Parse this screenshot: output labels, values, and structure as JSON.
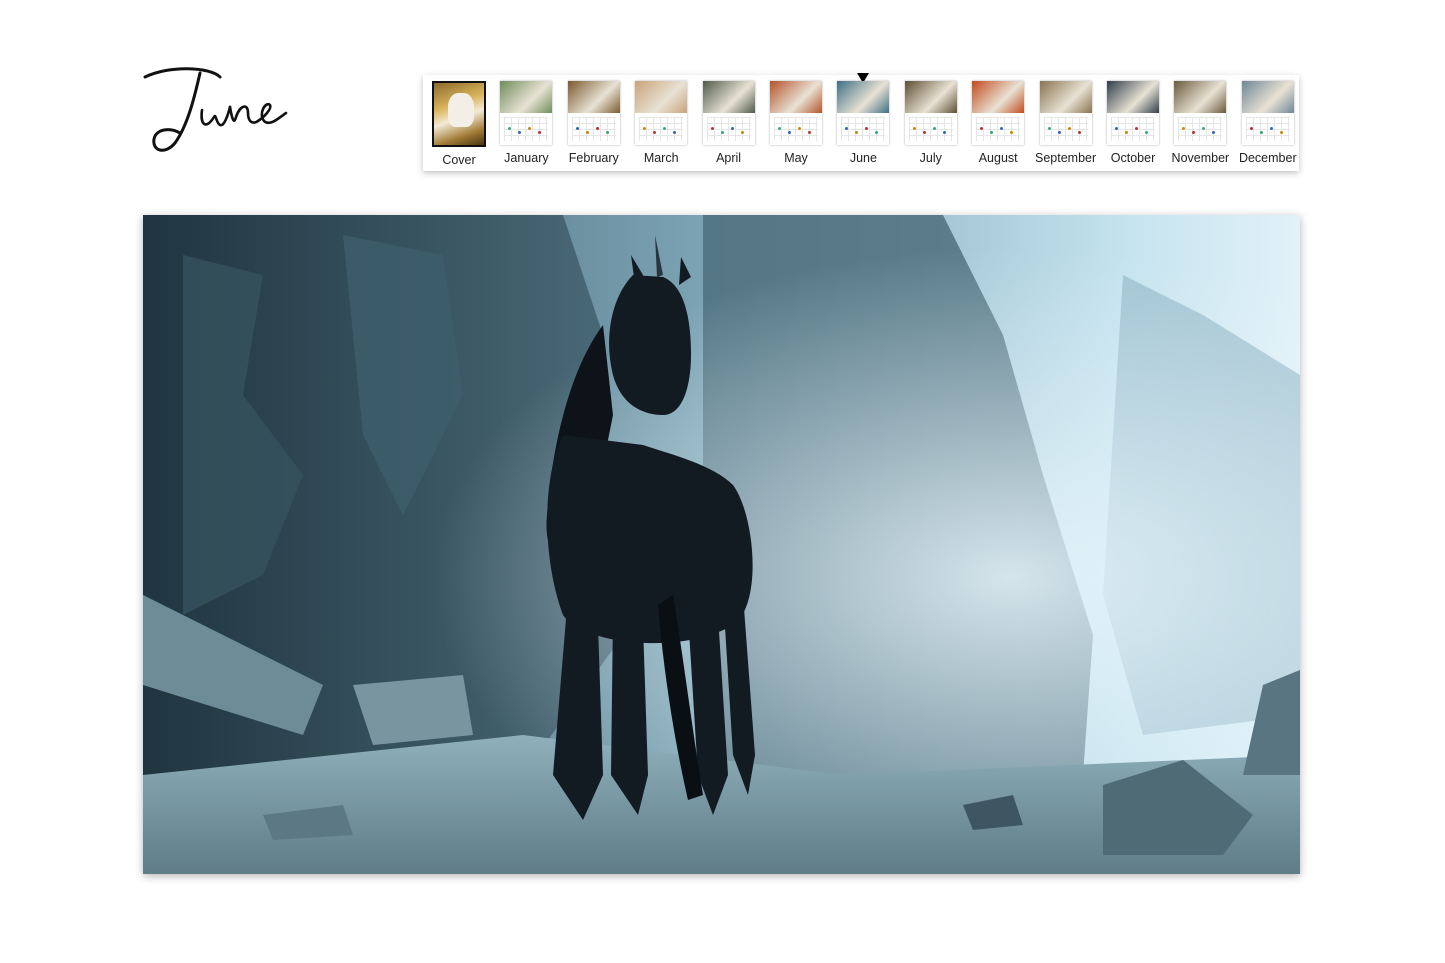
{
  "month_title": "June",
  "strip": {
    "selected": "June",
    "items": [
      {
        "label": "Cover",
        "photo": "#b08a3e"
      },
      {
        "label": "January",
        "photo": "#6f8d5a"
      },
      {
        "label": "February",
        "photo": "#7a5a2e"
      },
      {
        "label": "March",
        "photo": "#c9a27a"
      },
      {
        "label": "April",
        "photo": "#4f5a4a"
      },
      {
        "label": "May",
        "photo": "#b4532a"
      },
      {
        "label": "June",
        "photo": "#3d6f85"
      },
      {
        "label": "July",
        "photo": "#5e4f34"
      },
      {
        "label": "August",
        "photo": "#c24a1d"
      },
      {
        "label": "September",
        "photo": "#8a7350"
      },
      {
        "label": "October",
        "photo": "#2e3d4a"
      },
      {
        "label": "November",
        "photo": "#6b5a3e"
      },
      {
        "label": "December",
        "photo": "#6e8796"
      }
    ]
  },
  "hero": {
    "colors": {
      "sky": "#d8eef6",
      "rock": "#2c4652",
      "horse": "#121a22",
      "ground": "#9fb8c2"
    }
  }
}
